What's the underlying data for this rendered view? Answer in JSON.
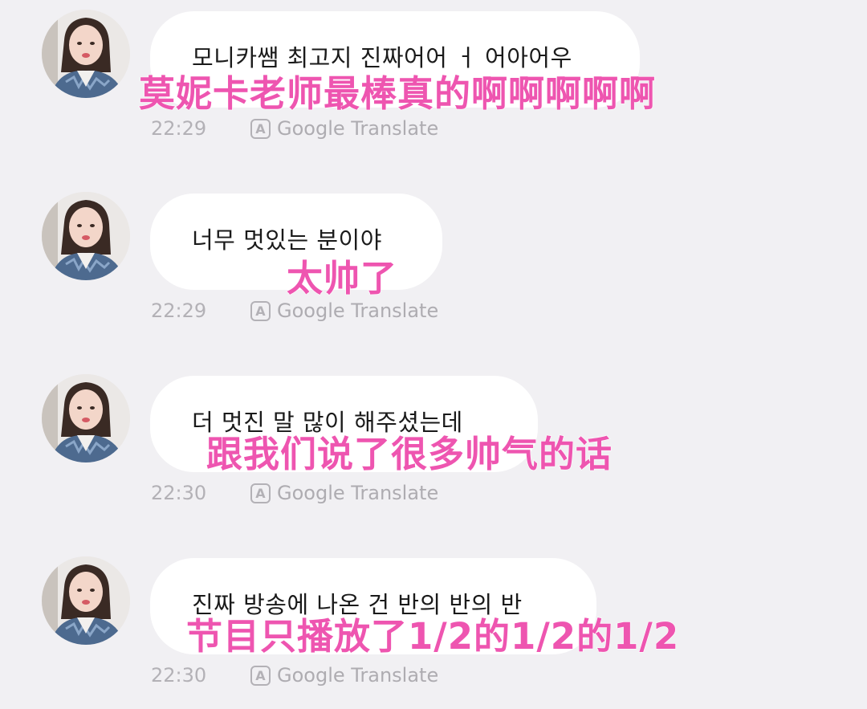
{
  "messages": [
    {
      "text": "모니카쌤 최고지 진짜어어 ㅓ 어아어우",
      "translation_overlay": "莫妮卡老师最棒真的啊啊啊啊啊",
      "time": "22:29",
      "translate_label": "Google Translate",
      "translate_icon_letter": "A"
    },
    {
      "text": "너무 멋있는 분이야",
      "translation_overlay": "太帅了",
      "time": "22:29",
      "translate_label": "Google Translate",
      "translate_icon_letter": "A"
    },
    {
      "text": "더 멋진 말 많이 해주셨는데",
      "translation_overlay": "跟我们说了很多帅气的话",
      "time": "22:30",
      "translate_label": "Google Translate",
      "translate_icon_letter": "A"
    },
    {
      "text": "진짜 방송에 나온 건 반의 반의 반",
      "translation_overlay": "节目只播放了1/2的1/2的1/2",
      "time": "22:30",
      "translate_label": "Google Translate",
      "translate_icon_letter": "A"
    }
  ],
  "colors": {
    "background": "#f1f0f3",
    "bubble": "#ffffff",
    "overlay_text": "#ee55b0",
    "meta_text": "#b3b1b6"
  },
  "icons": {
    "avatar": "profile-photo-icon",
    "translate": "translate-a-icon"
  }
}
